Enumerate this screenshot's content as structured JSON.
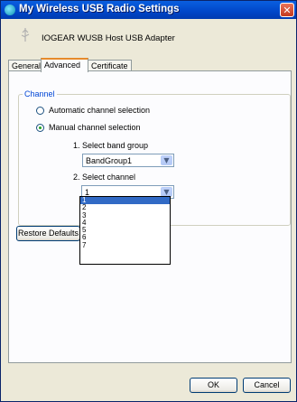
{
  "window": {
    "title": "My Wireless USB Radio Settings",
    "close_glyph": "✕"
  },
  "header": {
    "device_name": "IOGEAR WUSB Host USB Adapter",
    "icon": "usb-plug-icon"
  },
  "tabs": [
    {
      "label": "General"
    },
    {
      "label": "Advanced"
    },
    {
      "label": "Certificate"
    }
  ],
  "channel_group": {
    "label": "Channel",
    "auto_label": "Automatic channel selection",
    "manual_label": "Manual channel selection",
    "band_label": "1. Select band group",
    "band_value": "BandGroup1",
    "channel_label": "2. Select channel",
    "channel_value": "1",
    "selected_mode": "manual"
  },
  "channel_options": [
    "1",
    "2",
    "3",
    "4",
    "5",
    "6",
    "7"
  ],
  "buttons": {
    "restore": "Restore Defaults",
    "ok": "OK",
    "cancel": "Cancel"
  },
  "colors": {
    "title_bar": "#0046c8",
    "group_label": "#0046d5",
    "selected_option": "#316ac5"
  }
}
